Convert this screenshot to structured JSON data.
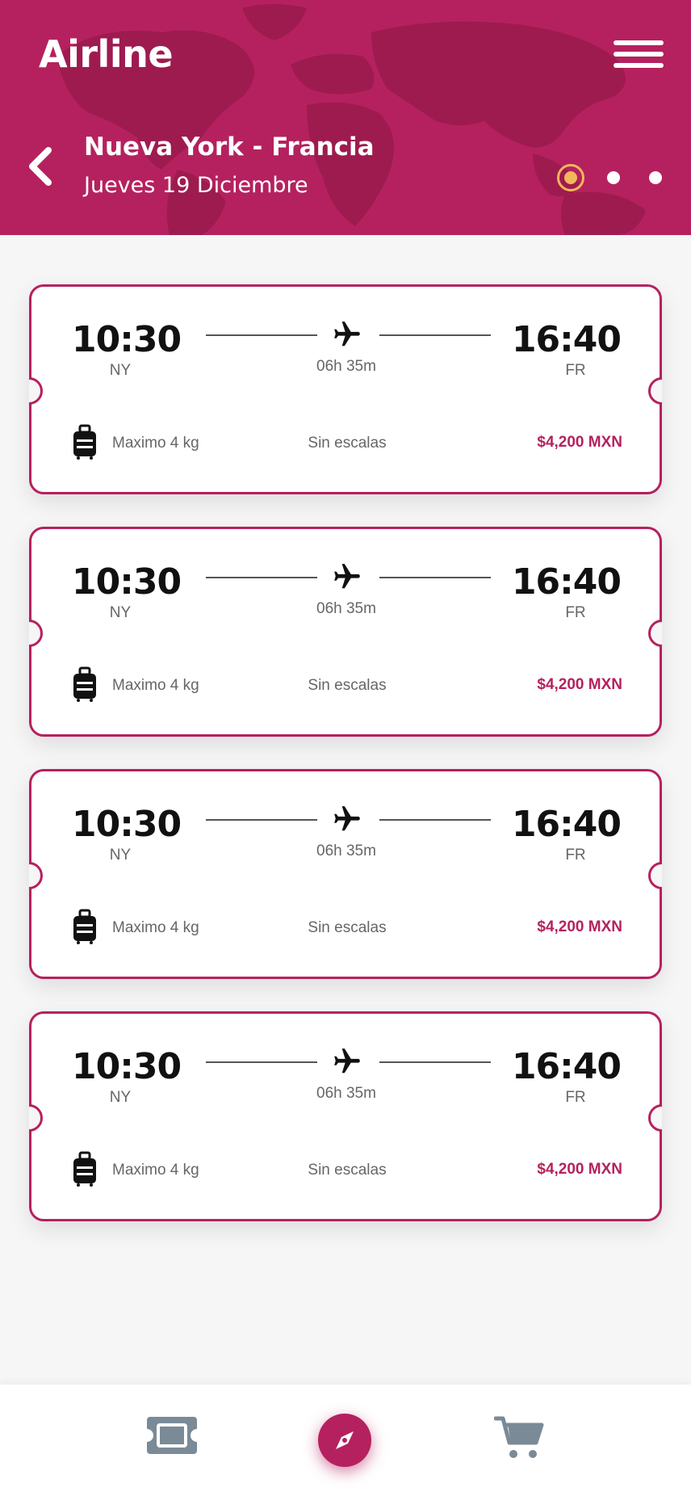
{
  "header": {
    "app_title": "Airline",
    "route_title": "Nueva York - Francia",
    "route_date": "Jueves 19 Diciembre",
    "pagination": {
      "total": 3,
      "active": 1
    }
  },
  "colors": {
    "brand": "#b5215e",
    "accent": "#f2b75a",
    "nav_icon": "#7a8a97"
  },
  "flights": [
    {
      "departure_time": "10:30",
      "departure_code": "NY",
      "arrival_time": "16:40",
      "arrival_code": "FR",
      "duration": "06h 35m",
      "baggage": "Maximo 4 kg",
      "stops": "Sin escalas",
      "price": "$4,200 MXN"
    },
    {
      "departure_time": "10:30",
      "departure_code": "NY",
      "arrival_time": "16:40",
      "arrival_code": "FR",
      "duration": "06h 35m",
      "baggage": "Maximo 4 kg",
      "stops": "Sin escalas",
      "price": "$4,200 MXN"
    },
    {
      "departure_time": "10:30",
      "departure_code": "NY",
      "arrival_time": "16:40",
      "arrival_code": "FR",
      "duration": "06h 35m",
      "baggage": "Maximo 4 kg",
      "stops": "Sin escalas",
      "price": "$4,200 MXN"
    },
    {
      "departure_time": "10:30",
      "departure_code": "NY",
      "arrival_time": "16:40",
      "arrival_code": "FR",
      "duration": "06h 35m",
      "baggage": "Maximo 4 kg",
      "stops": "Sin escalas",
      "price": "$4,200 MXN"
    }
  ],
  "bottom_nav": {
    "items": [
      {
        "icon": "ticket-icon"
      },
      {
        "icon": "compass-icon",
        "active": true
      },
      {
        "icon": "cart-icon"
      }
    ]
  }
}
